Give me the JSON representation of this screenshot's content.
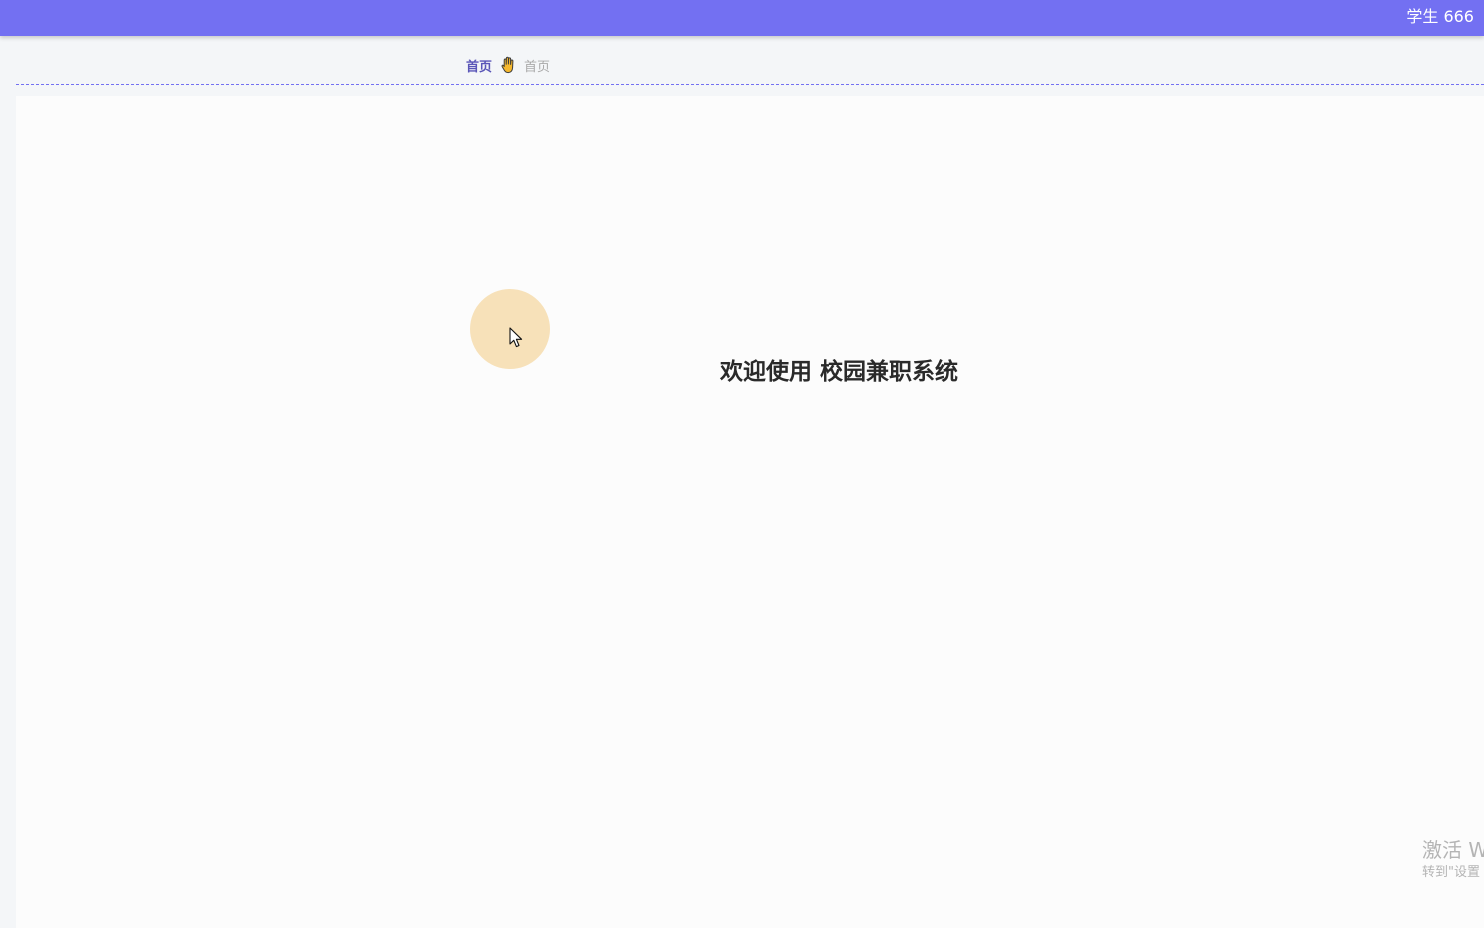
{
  "header": {
    "user_label": "学生 666",
    "bar_color": "#7370f2"
  },
  "breadcrumb": {
    "home_label": "首页",
    "separator_icon": "hand-icon",
    "current_label": "首页"
  },
  "main": {
    "welcome_text": "欢迎使用 校园兼职系统"
  },
  "overlay": {
    "watermark_title": "激活 W",
    "watermark_subtitle": "转到\"设置"
  }
}
